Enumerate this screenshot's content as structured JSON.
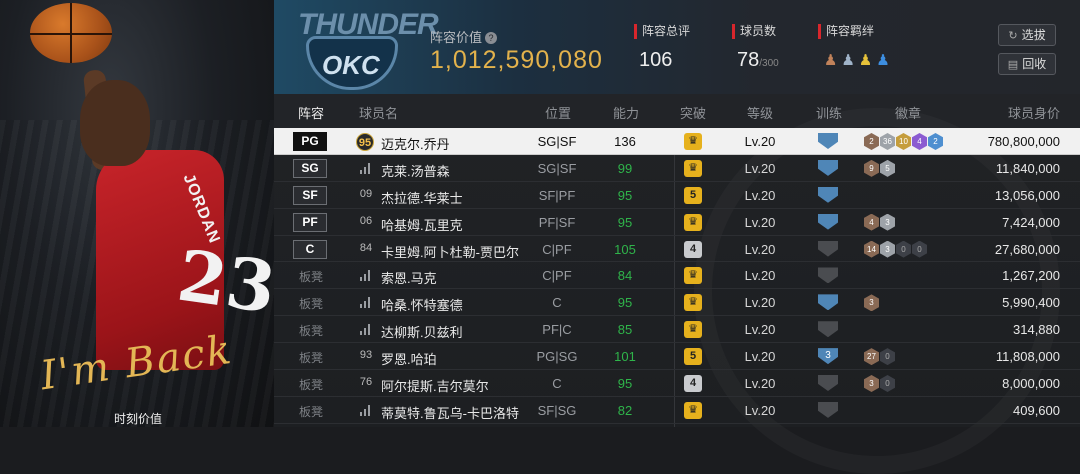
{
  "left_panel": {
    "script_text": "I'm Back",
    "moment_label": "时刻价值",
    "jersey_name": "JORDAN",
    "jersey_number": "23"
  },
  "header": {
    "team_wordmark": "THUNDER",
    "team_abbr": "OKC",
    "value_label": "阵容价值",
    "value": "1,012,590,080",
    "total_rating_label": "阵容总评",
    "total_rating": "106",
    "player_count_label": "球员数",
    "player_count": "78",
    "player_count_max": "/300",
    "fetter_label": "阵容羁绊",
    "select_button": "选拔",
    "recycle_button": "回收"
  },
  "columns": [
    "阵容",
    "球员名",
    "位置",
    "能力",
    "突破",
    "等级",
    "训练",
    "徽章",
    "球员身价"
  ],
  "rows": [
    {
      "slot": "PG",
      "ovr": "95",
      "name": "迈克尔.乔丹",
      "pos": "SG|SF",
      "rating": "136",
      "break": "♛",
      "level": "Lv.20",
      "train": "",
      "badges": [
        [
          "2",
          "bronze"
        ],
        [
          "36",
          "silver"
        ],
        [
          "10",
          "gold"
        ],
        [
          "4",
          "purple"
        ],
        [
          "2",
          "blue"
        ]
      ],
      "salary": "780,800,000",
      "selected": true
    },
    {
      "slot": "SG",
      "ovr": "",
      "name": "克莱.汤普森",
      "pos": "SG|SF",
      "rating": "99",
      "break": "♛",
      "level": "Lv.20",
      "train": "",
      "badges": [
        [
          "9",
          "bronze"
        ],
        [
          "5",
          "silver"
        ]
      ],
      "salary": "11,840,000"
    },
    {
      "slot": "SF",
      "ovr": "09",
      "name": "杰拉德.华莱士",
      "pos": "SF|PF",
      "rating": "95",
      "break": "5",
      "level": "Lv.20",
      "train": "",
      "badges": [],
      "salary": "13,056,000"
    },
    {
      "slot": "PF",
      "ovr": "06",
      "name": "哈基姆.瓦里克",
      "pos": "PF|SF",
      "rating": "95",
      "break": "♛",
      "level": "Lv.20",
      "train": "",
      "badges": [
        [
          "4",
          "bronze"
        ],
        [
          "3",
          "silver"
        ]
      ],
      "salary": "7,424,000"
    },
    {
      "slot": "C",
      "ovr": "84",
      "name": "卡里姆.阿卜杜勒-贾巴尔",
      "pos": "C|PF",
      "rating": "105",
      "break": "4",
      "level": "Lv.20",
      "train": "empty",
      "badges": [
        [
          "14",
          "bronze"
        ],
        [
          "3",
          "silver"
        ],
        [
          "0",
          "dark"
        ],
        [
          "0",
          "dark"
        ]
      ],
      "salary": "27,680,000"
    },
    {
      "slot": "板凳",
      "ovr": "",
      "name": "索恩.马克",
      "pos": "C|PF",
      "rating": "84",
      "break": "♛",
      "level": "Lv.20",
      "train": "empty",
      "badges": [],
      "salary": "1,267,200"
    },
    {
      "slot": "板凳",
      "ovr": "",
      "name": "哈桑.怀特塞德",
      "pos": "C",
      "rating": "95",
      "break": "♛",
      "level": "Lv.20",
      "train": "",
      "badges": [
        [
          "3",
          "bronze"
        ]
      ],
      "salary": "5,990,400"
    },
    {
      "slot": "板凳",
      "ovr": "",
      "name": "达柳斯.贝兹利",
      "pos": "PF|C",
      "rating": "85",
      "break": "♛",
      "level": "Lv.20",
      "train": "empty",
      "badges": [],
      "salary": "314,880"
    },
    {
      "slot": "板凳",
      "ovr": "93",
      "name": "罗恩.哈珀",
      "pos": "PG|SG",
      "rating": "101",
      "break": "5",
      "level": "Lv.20",
      "train": "3",
      "badges": [
        [
          "27",
          "bronze"
        ],
        [
          "0",
          "dark"
        ]
      ],
      "salary": "11,808,000"
    },
    {
      "slot": "板凳",
      "ovr": "76",
      "name": "阿尔提斯.吉尔莫尔",
      "pos": "C",
      "rating": "95",
      "break": "4",
      "level": "Lv.20",
      "train": "empty",
      "badges": [
        [
          "3",
          "bronze"
        ],
        [
          "0",
          "dark"
        ]
      ],
      "salary": "8,000,000"
    },
    {
      "slot": "板凳",
      "ovr": "",
      "name": "蒂莫特.鲁瓦乌-卡巴洛特",
      "pos": "SF|SG",
      "rating": "82",
      "break": "♛",
      "level": "Lv.20",
      "train": "empty",
      "badges": [],
      "salary": "409,600"
    }
  ]
}
